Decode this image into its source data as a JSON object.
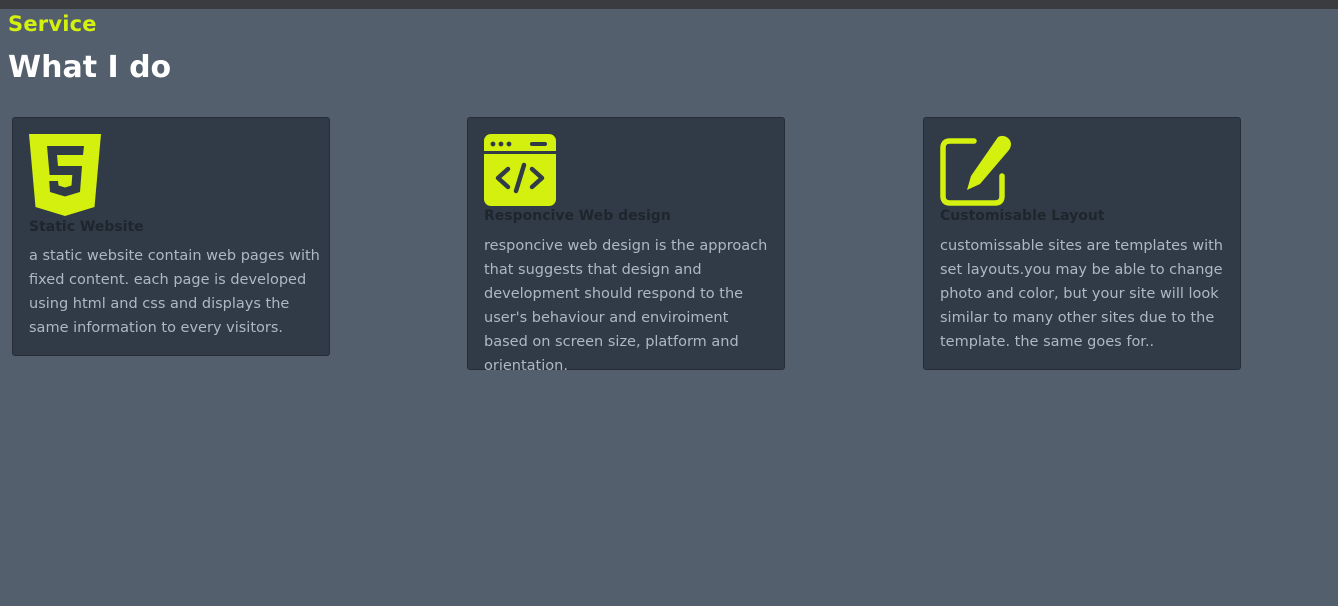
{
  "header": {
    "eyebrow": "Service",
    "title": "What I do"
  },
  "colors": {
    "accent": "#d4f00e",
    "background": "#535f6c",
    "card": "#313b47"
  },
  "cards": [
    {
      "icon": "html5-icon",
      "title": "Static Website",
      "text": "a static website contain web pages with fixed content. each page is developed using html and css and displays the same information to every visitors."
    },
    {
      "icon": "code-window-icon",
      "title": "Responcive Web design",
      "text": "responcive web design is the approach that suggests that design and development should respond to the user's behaviour and enviroiment based on screen size, platform and orientation."
    },
    {
      "icon": "edit-icon",
      "title": "Customisable Layout",
      "text": "customissable sites are templates with set layouts.you may be able to change photo and color, but your site will look similar to many other sites due to the template. the same goes for.."
    }
  ]
}
